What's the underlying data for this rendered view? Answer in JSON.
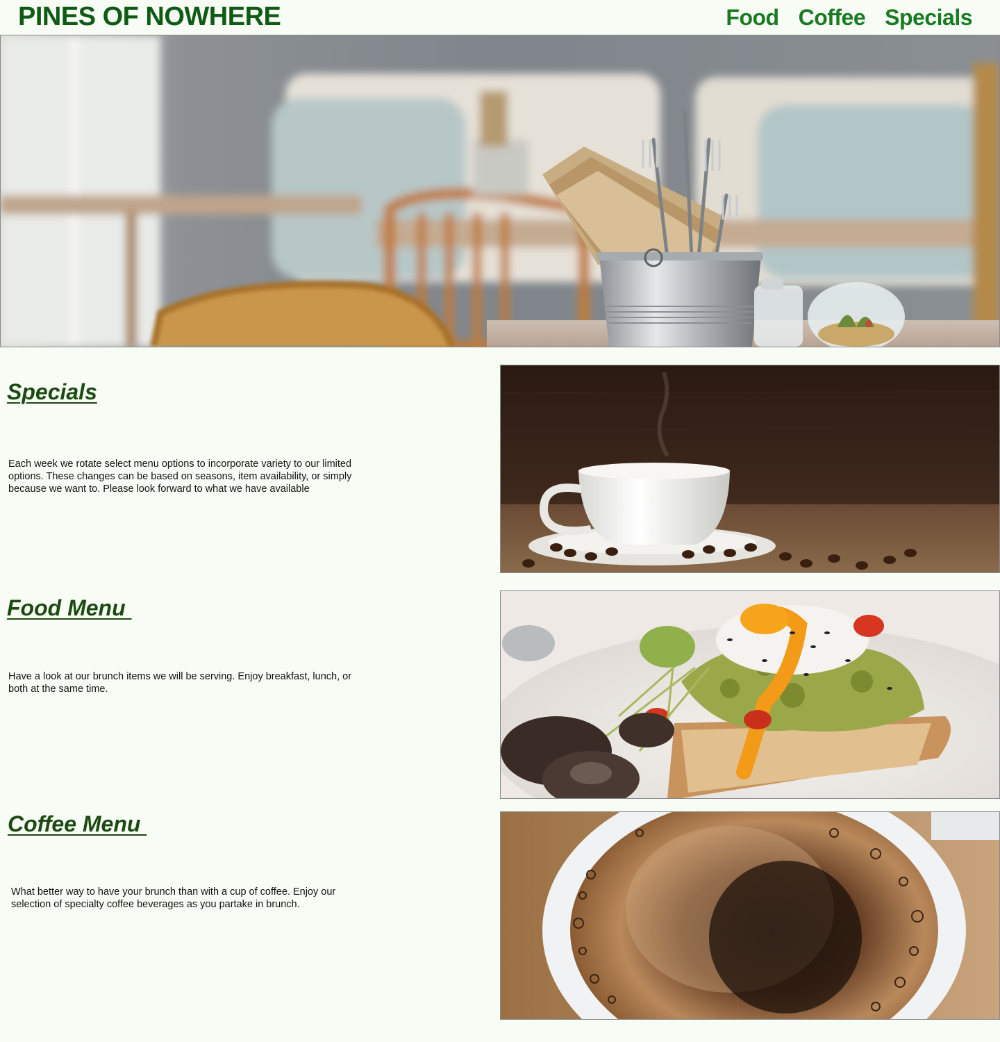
{
  "header": {
    "brand": "PINES OF NOWHERE",
    "nav": [
      {
        "label": "Food"
      },
      {
        "label": "Coffee"
      },
      {
        "label": "Specials"
      }
    ]
  },
  "sections": [
    {
      "title": "Specials",
      "text": "Each week we rotate select menu options to incorporate variety to our limited options. These changes can be based on seasons, item availability, or simply because we want to. Please look forward to what we have available"
    },
    {
      "title": "Food Menu ",
      "text": "Have a look at our brunch items we will be serving. Enjoy breakfast, lunch, or both at the same time."
    },
    {
      "title": "Coffee Menu ",
      "text": "What better way to have your brunch than with a cup of coffee. Enjoy our selection of specialty coffee beverages as you partake in brunch."
    }
  ],
  "colors": {
    "background": "#f7fdf5",
    "brand": "#0f5a14",
    "nav": "#1a7a22",
    "heading": "#1c4a12"
  }
}
